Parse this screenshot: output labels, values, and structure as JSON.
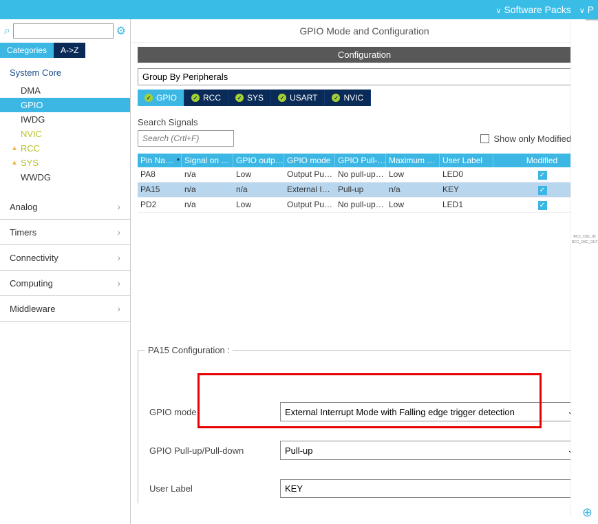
{
  "topbar": {
    "item1": "Software Packs",
    "item2": "P"
  },
  "left": {
    "tabs": {
      "categories": "Categories",
      "az": "A->Z"
    },
    "sections": {
      "system_core": "System Core",
      "items": [
        "DMA",
        "GPIO",
        "IWDG",
        "NVIC",
        "RCC",
        "SYS",
        "WWDG"
      ],
      "analog": "Analog",
      "timers": "Timers",
      "connectivity": "Connectivity",
      "computing": "Computing",
      "middleware": "Middleware"
    }
  },
  "right": {
    "title": "GPIO Mode and Configuration",
    "config_banner": "Configuration",
    "group_by": "Group By Peripherals",
    "ptabs": [
      "GPIO",
      "RCC",
      "SYS",
      "USART",
      "NVIC"
    ],
    "search_signals_label": "Search Signals",
    "search_signals_ph": "Search (Crtl+F)",
    "show_modified": "Show only Modified Pins",
    "table": {
      "headers": [
        "Pin Na…",
        "Signal on …",
        "GPIO outp…",
        "GPIO mode",
        "GPIO Pull-…",
        "Maximum …",
        "User Label",
        "Modified"
      ],
      "rows": [
        {
          "c": [
            "PA8",
            "n/a",
            "Low",
            "Output Pu…",
            "No pull-up…",
            "Low",
            "LED0"
          ],
          "mod": true,
          "sel": false
        },
        {
          "c": [
            "PA15",
            "n/a",
            "n/a",
            "External I…",
            "Pull-up",
            "n/a",
            "KEY"
          ],
          "mod": true,
          "sel": true
        },
        {
          "c": [
            "PD2",
            "n/a",
            "Low",
            "Output Pu…",
            "No pull-up…",
            "Low",
            "LED1"
          ],
          "mod": true,
          "sel": false
        }
      ]
    },
    "pin_conf": {
      "legend": "PA15 Configuration :",
      "mode_label": "GPIO mode",
      "mode_value": "External Interrupt Mode with Falling edge trigger detection",
      "pull_label": "GPIO Pull-up/Pull-down",
      "pull_value": "Pull-up",
      "label_label": "User Label",
      "label_value": "KEY"
    }
  },
  "gutter": {
    "l1": "RCC_OSC_IN",
    "l2": "RCC_OSC_OUT"
  }
}
